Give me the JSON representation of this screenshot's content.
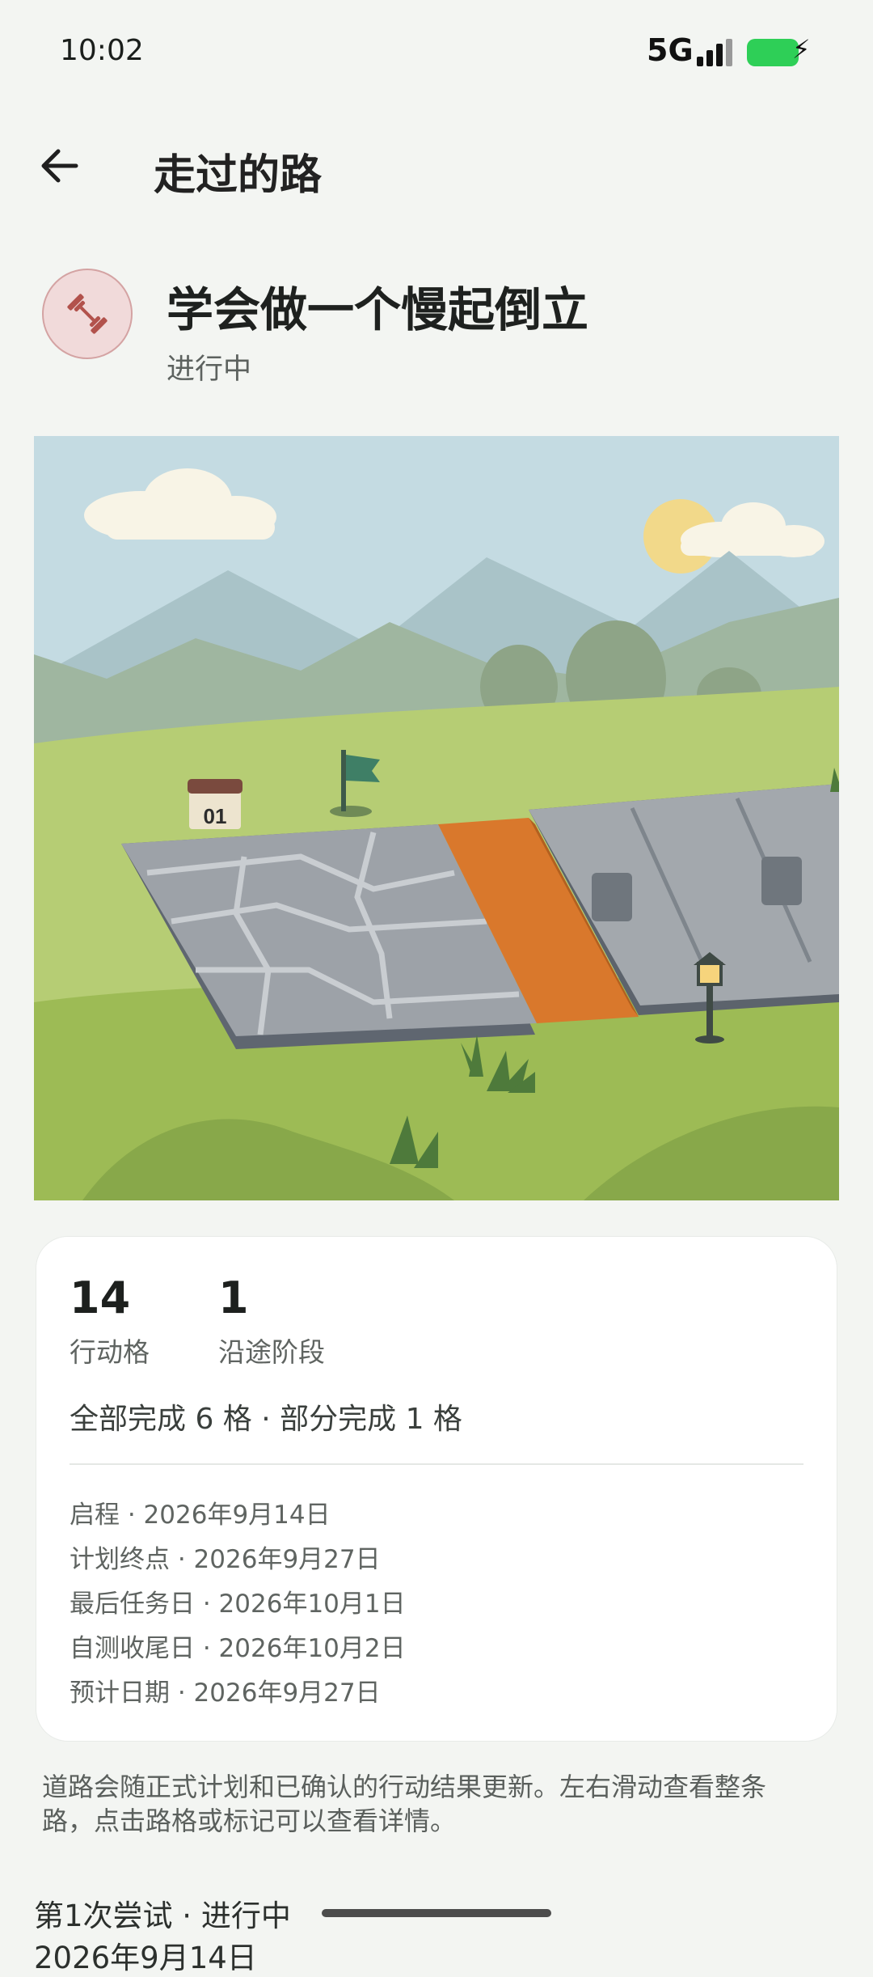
{
  "status_bar": {
    "time": "10:02",
    "network": "5G",
    "battery_charging_icon": "bolt-icon"
  },
  "header": {
    "title": "走过的路"
  },
  "goal": {
    "title": "学会做一个慢起倒立",
    "status": "进行中",
    "icon": "dumbbell-icon"
  },
  "scene": {
    "milestone_label": "01"
  },
  "stats": {
    "action_cells": {
      "value": "14",
      "label": "行动格"
    },
    "stages": {
      "value": "1",
      "label": "沿途阶段"
    },
    "summary": "全部完成 6 格 · 部分完成 1 格"
  },
  "dates": [
    "启程 · 2026年9月14日",
    "计划终点 · 2026年9月27日",
    "最后任务日 · 2026年10月1日",
    "自测收尾日 · 2026年10月2日",
    "预计日期 · 2026年9月27日"
  ],
  "note": "道路会随正式计划和已确认的行动结果更新。左右滑动查看整条路，点击路格或标记可以查看详情。",
  "attempt": {
    "label": "第1次尝试 · 进行中",
    "sub": "2026年9月14日"
  },
  "colors": {
    "accent_orange": "#d9782c",
    "grass": "#a9c46a",
    "battery": "#2ecf57"
  }
}
